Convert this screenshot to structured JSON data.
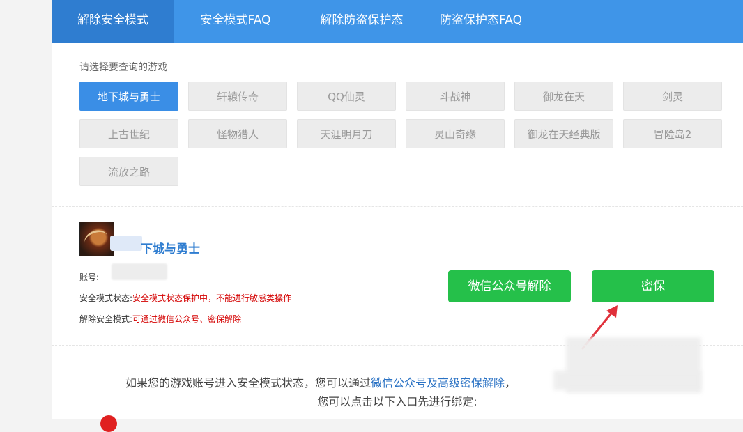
{
  "tabs": [
    {
      "label": "解除安全模式",
      "active": true
    },
    {
      "label": "安全模式FAQ",
      "active": false
    },
    {
      "label": "解除防盗保护态",
      "active": false
    },
    {
      "label": "防盗保护态FAQ",
      "active": false
    }
  ],
  "prompt": "请选择要查询的游戏",
  "games": [
    "地下城与勇士",
    "轩辕传奇",
    "QQ仙灵",
    "斗战神",
    "御龙在天",
    "剑灵",
    "上古世纪",
    "怪物猎人",
    "天涯明月刀",
    "灵山奇缘",
    "御龙在天经典版",
    "冒险岛2",
    "流放之路"
  ],
  "selected_game": "地下城与勇士",
  "info": {
    "title_visible": "下城与勇士",
    "account_label": "账号:",
    "status_label": "安全模式状态:",
    "status_value": "安全模式状态保护中，不能进行敏感类操作",
    "unlock_label": "解除安全模式:",
    "unlock_value": "可通过微信公众号、密保解除"
  },
  "buttons": {
    "wechat": "微信公众号解除",
    "mibao": "密保"
  },
  "bottom": {
    "line1_prefix": "如果您的游戏账号进入安全模式状态，您可以通过",
    "line1_link": "微信公众号及高级密保解除",
    "line1_suffix": "，",
    "line2": "您可以点击以下入口先进行绑定:"
  },
  "colors": {
    "tabbar": "#3f95e8",
    "selected": "#3a8ee6",
    "green": "#25c04a",
    "warning": "#d40000",
    "arrow": "#e0303a"
  }
}
